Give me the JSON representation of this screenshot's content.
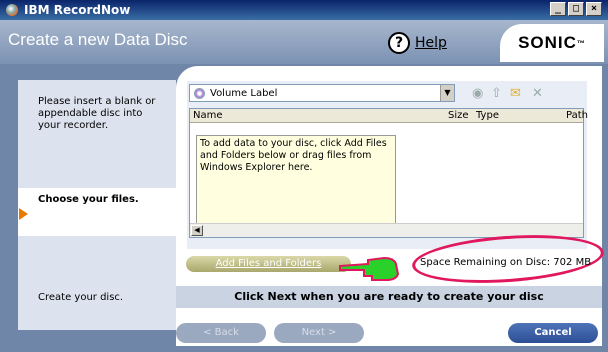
{
  "window": {
    "title": "IBM RecordNow",
    "btn_min": "_",
    "btn_max": "□",
    "btn_close": "×"
  },
  "header": {
    "title": "Create a new Data Disc",
    "help_symbol": "?",
    "help_label": "Help",
    "brand": "SONIC",
    "brand_tm": "™"
  },
  "steps": {
    "insert": "Please insert a blank or appendable disc into your recorder.",
    "choose": "Choose your files.",
    "create": "Create your disc."
  },
  "volume": {
    "label": "Volume Label"
  },
  "columns": {
    "name": "Name",
    "size": "Size",
    "type": "Type",
    "path": "Path"
  },
  "empty_note": "To add data to your disc, click Add Files and Folders below or drag files from Windows Explorer here.",
  "add_button": "Add Files and Folders",
  "space_remaining": "Space Remaining on Disc: 702 MB",
  "message": "Click Next when you are ready to create your disc",
  "nav": {
    "back": "< Back",
    "next": "Next >",
    "cancel": "Cancel"
  },
  "colors": {
    "accent": "#2c4f96",
    "highlight_oval": "#e1185d",
    "arrow": "#e87a00",
    "hand": "#2bd12b"
  }
}
